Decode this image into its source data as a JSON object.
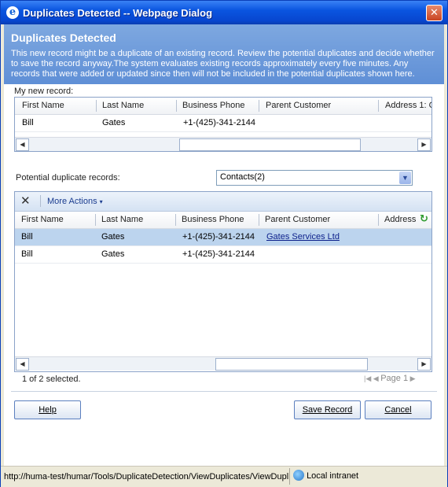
{
  "window": {
    "title": "Duplicates Detected -- Webpage Dialog"
  },
  "header": {
    "title": "Duplicates Detected",
    "description": "This new record might be a duplicate of an existing record. Review the potential duplicates and decide whether to save the record anyway.The system evaluates existing records approximately every five minutes. Any records that were added or updated since then will not be included in the potential duplicates shown here."
  },
  "new_record": {
    "label": "My new record:",
    "columns": [
      "First Name",
      "Last Name",
      "Business Phone",
      "Parent Customer",
      "Address 1: C"
    ],
    "row": {
      "first": "Bill",
      "last": "Gates",
      "phone": "+1-(425)-341-2144"
    }
  },
  "duplicates": {
    "label": "Potential duplicate records:",
    "entity_select": "Contacts(2)",
    "more_actions": "More Actions",
    "columns": [
      "First Name",
      "Last Name",
      "Business Phone",
      "Parent Customer",
      "Address"
    ],
    "rows": [
      {
        "first": "Bill",
        "last": "Gates",
        "phone": "+1-(425)-341-2144",
        "parent": "Gates Services Ltd"
      },
      {
        "first": "Bill",
        "last": "Gates",
        "phone": "+1-(425)-341-2144",
        "parent": ""
      }
    ],
    "selection": "1 of 2 selected.",
    "page": "Page 1"
  },
  "buttons": {
    "help": "Help",
    "save": "Save Record",
    "cancel": "Cancel"
  },
  "statusbar": {
    "url": "http://huma-test/humar/Tools/DuplicateDetection/ViewDuplicates/ViewDuplicates.aspx",
    "zone": "Local intranet"
  },
  "colors": {
    "selected_row": "#bcd4ee",
    "header_band": "#6b98d9",
    "titlebar": "#0a55e0"
  }
}
